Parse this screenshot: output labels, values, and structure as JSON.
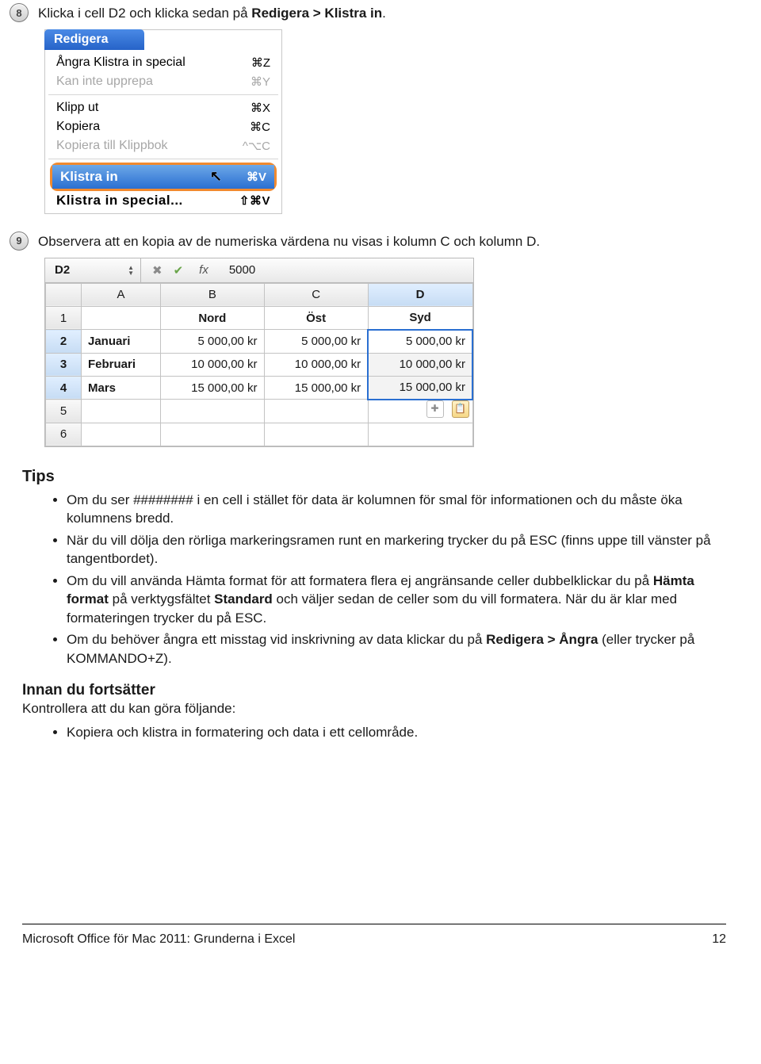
{
  "step8": {
    "num": "8",
    "pre": "Klicka i cell D2 och klicka sedan på ",
    "bold": "Redigera > Klistra in",
    "post": "."
  },
  "menu": {
    "title": "Redigera",
    "items": [
      {
        "label": "Ångra Klistra in special",
        "shortcut": "⌘Z",
        "disabled": false
      },
      {
        "label": "Kan inte upprepa",
        "shortcut": "⌘Y",
        "disabled": true
      }
    ],
    "items2": [
      {
        "label": "Klipp ut",
        "shortcut": "⌘X",
        "disabled": false
      },
      {
        "label": "Kopiera",
        "shortcut": "⌘C",
        "disabled": false
      },
      {
        "label": "Kopiera till Klippbok",
        "shortcut": "^⌥C",
        "disabled": true
      }
    ],
    "highlight": {
      "label": "Klistra in",
      "shortcut": "⌘V"
    },
    "special": {
      "label": "Klistra in special...",
      "shortcut": "⇧⌘V"
    }
  },
  "step9": {
    "num": "9",
    "text": "Observera att en kopia av de numeriska värdena nu visas i kolumn C och kolumn D."
  },
  "sheet": {
    "ref": "D2",
    "fx": "fx",
    "value": "5000",
    "cols": [
      "",
      "A",
      "B",
      "C",
      "D"
    ],
    "active_col_idx": 4,
    "headers": [
      "",
      "Nord",
      "Öst",
      "Syd"
    ],
    "rows": [
      {
        "n": "1",
        "lab": "",
        "b": "Nord",
        "c": "Öst",
        "d": "Syd",
        "header": true
      },
      {
        "n": "2",
        "lab": "Januari",
        "b": "5 000,00 kr",
        "c": "5 000,00 kr",
        "d": "5 000,00 kr"
      },
      {
        "n": "3",
        "lab": "Februari",
        "b": "10 000,00 kr",
        "c": "10 000,00 kr",
        "d": "10 000,00 kr"
      },
      {
        "n": "4",
        "lab": "Mars",
        "b": "15 000,00 kr",
        "c": "15 000,00 kr",
        "d": "15 000,00 kr"
      },
      {
        "n": "5",
        "lab": "",
        "b": "",
        "c": "",
        "d": ""
      },
      {
        "n": "6",
        "lab": "",
        "b": "",
        "c": "",
        "d": ""
      }
    ]
  },
  "tips": {
    "heading": "Tips",
    "bullets": [
      "Om du ser ######## i en cell i stället för data är kolumnen för smal för informationen och du måste öka kolumnens bredd.",
      "När du vill dölja den rörliga markeringsramen runt en markering trycker du på ESC (finns uppe till vänster på tangentbordet).",
      {
        "pre": "Om du vill använda Hämta format för att formatera flera ej angränsande celler dubbelklickar du på ",
        "b1": "Hämta format",
        "mid": " på verktygsfältet ",
        "b2": "Standard",
        "post": " och väljer sedan de celler som du vill formatera. När du är klar med formateringen trycker du på ESC."
      },
      {
        "pre": "Om du behöver ångra ett misstag vid inskrivning av data klickar du på ",
        "b1": "Redigera > Ångra",
        "post": " (eller trycker på KOMMANDO+Z)."
      }
    ]
  },
  "innan": {
    "heading": "Innan du fortsätter",
    "sub": "Kontrollera att du kan göra följande:",
    "bullets": [
      "Kopiera och klistra in formatering och data i ett cellområde."
    ]
  },
  "footer": {
    "title": "Microsoft Office för Mac 2011: Grunderna i Excel",
    "page": "12"
  }
}
